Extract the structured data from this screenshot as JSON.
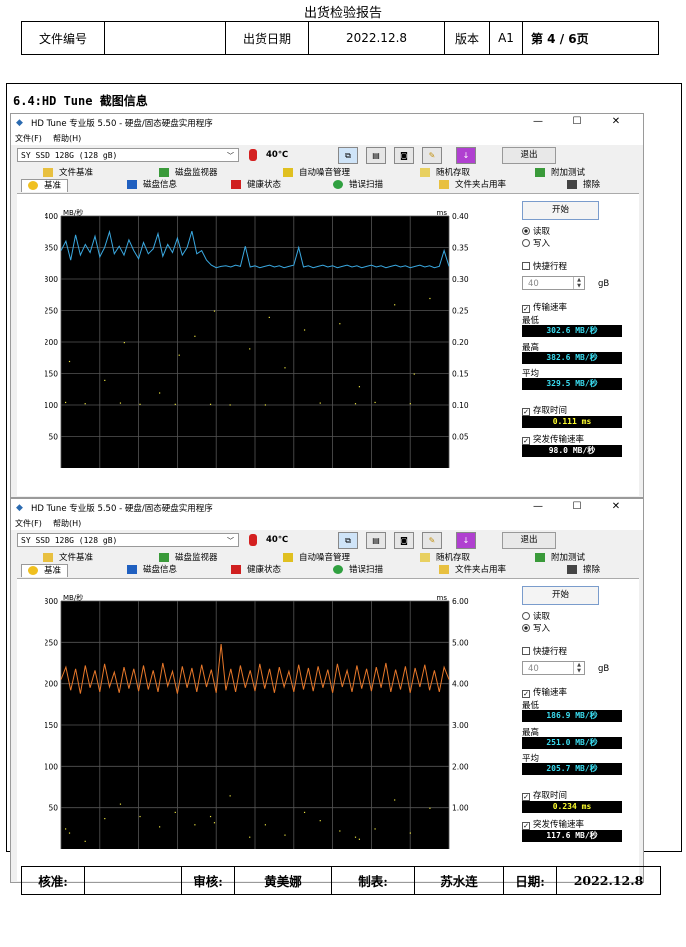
{
  "document": {
    "title": "出货检验报告",
    "header": {
      "doc_number_label": "文件编号",
      "doc_number_value": "",
      "ship_date_label": "出货日期",
      "ship_date_value": "2022.12.8",
      "version_label": "版本",
      "version_value": "A1",
      "page": "第 4 / 6页"
    },
    "section_title": "6.4:HD Tune 截图信息",
    "footer": {
      "approve_label": "核准:",
      "approve_value": "",
      "review_label": "审核:",
      "review_value": "黄美娜",
      "prepare_label": "制表:",
      "prepare_value": "苏水连",
      "date_label": "日期:",
      "date_value": "2022.12.8"
    }
  },
  "hdtune": {
    "window_title": "HD Tune 专业版 5.50 - 硬盘/固态硬盘实用程序",
    "menu": [
      "文件(F)",
      "帮助(H)"
    ],
    "drive": "SY SSD 128G (128 gB)",
    "temperature": "40℃",
    "exit_label": "退出",
    "tabs_row1": [
      "文件基准",
      "磁盘监视器",
      "自动噪音管理",
      "随机存取",
      "附加测试"
    ],
    "tabs_row2": [
      "基准",
      "磁盘信息",
      "健康状态",
      "错误扫描",
      "文件夹占用率",
      "擦除"
    ],
    "start_label": "开始",
    "read_label": "读取",
    "write_label": "写入",
    "short_stroke_label": "快捷行程",
    "short_stroke_value": "40",
    "short_stroke_unit": "gB",
    "transfer_rate_label": "传输速率",
    "min_label": "最低",
    "max_label": "最高",
    "avg_label": "平均",
    "access_time_label": "存取时间",
    "burst_rate_label": "突发传输速率",
    "y_unit_left": "MB/秒",
    "y_unit_right": "ms"
  },
  "read_test": {
    "mode": "read",
    "min": "302.6 MB/秒",
    "max": "382.6 MB/秒",
    "avg": "329.5 MB/秒",
    "access_time": "0.111 ms",
    "burst": "98.0 MB/秒"
  },
  "write_test": {
    "mode": "write",
    "min": "186.9 MB/秒",
    "max": "251.0 MB/秒",
    "avg": "205.7 MB/秒",
    "access_time": "0.234 ms",
    "burst": "117.6 MB/秒"
  },
  "chart_data": [
    {
      "type": "line",
      "title": "",
      "xlabel": "",
      "ylabel": "MB/秒",
      "y2label": "ms",
      "ylim": [
        0,
        400
      ],
      "y2lim": [
        0,
        0.4
      ],
      "yticks": [
        50,
        100,
        150,
        200,
        250,
        300,
        350,
        400
      ],
      "y2ticks": [
        "0.05",
        "0.10",
        "0.15",
        "0.20",
        "0.25",
        "0.30",
        "0.35",
        "0.40"
      ],
      "grid": true,
      "line_color": "#3aa8e0",
      "scatter_color": "#e8e040",
      "transfer_rate": [
        345,
        360,
        330,
        370,
        338,
        355,
        342,
        368,
        335,
        350,
        375,
        340,
        352,
        338,
        362,
        345,
        332,
        358,
        340,
        348,
        372,
        336,
        355,
        342,
        365,
        338,
        350,
        376,
        340,
        345,
        330,
        322,
        318,
        320,
        321,
        319,
        322,
        320,
        352,
        319,
        321,
        318,
        320,
        322,
        319,
        321,
        318,
        320,
        322,
        350,
        319,
        321,
        318,
        320,
        322,
        319,
        321,
        318,
        320,
        322,
        319,
        321,
        318,
        320,
        322,
        319,
        321,
        318,
        320,
        322,
        319,
        321,
        318,
        320,
        322,
        319,
        321,
        318,
        320,
        345,
        320
      ],
      "access_time_points_ms": [
        0.105,
        0.102,
        0.103,
        0.104,
        0.101,
        0.103,
        0.102,
        0.104,
        0.103,
        0.101,
        0.105,
        0.102,
        0.16,
        0.27,
        0.21,
        0.23,
        0.14,
        0.19,
        0.26,
        0.12,
        0.22,
        0.17,
        0.25,
        0.13,
        0.2,
        0.24,
        0.15,
        0.18
      ]
    },
    {
      "type": "line",
      "title": "",
      "xlabel": "",
      "ylabel": "MB/秒",
      "y2label": "ms",
      "ylim": [
        0,
        300
      ],
      "y2lim": [
        0,
        6.0
      ],
      "yticks": [
        50,
        100,
        150,
        200,
        250,
        300
      ],
      "y2ticks": [
        "1.00",
        "2.00",
        "3.00",
        "4.00",
        "5.00",
        "6.00"
      ],
      "grid": true,
      "line_color": "#e8782a",
      "scatter_color": "#e8e040",
      "transfer_rate": [
        205,
        220,
        192,
        218,
        188,
        222,
        195,
        216,
        190,
        224,
        196,
        214,
        189,
        220,
        194,
        218,
        191,
        222,
        193,
        216,
        190,
        225,
        197,
        215,
        188,
        221,
        195,
        219,
        190,
        223,
        196,
        217,
        189,
        248,
        192,
        218,
        190,
        222,
        195,
        216,
        191,
        224,
        194,
        218,
        189,
        220,
        196,
        215,
        190,
        223,
        193,
        219,
        191,
        221,
        195,
        217,
        189,
        224,
        196,
        216,
        190,
        222,
        194,
        218,
        191,
        220,
        195,
        225,
        190,
        217,
        193,
        221,
        189,
        219,
        196,
        223,
        192,
        216,
        190,
        220,
        205
      ],
      "access_time_points_ms": [
        0.5,
        0.8,
        0.3,
        1.1,
        0.6,
        0.4,
        0.9,
        0.7,
        0.2,
        1.3,
        0.5,
        0.8,
        0.35,
        1.0,
        0.6,
        0.45,
        0.75,
        0.3,
        1.2,
        0.55,
        0.9,
        0.4,
        0.65,
        0.25
      ]
    }
  ]
}
